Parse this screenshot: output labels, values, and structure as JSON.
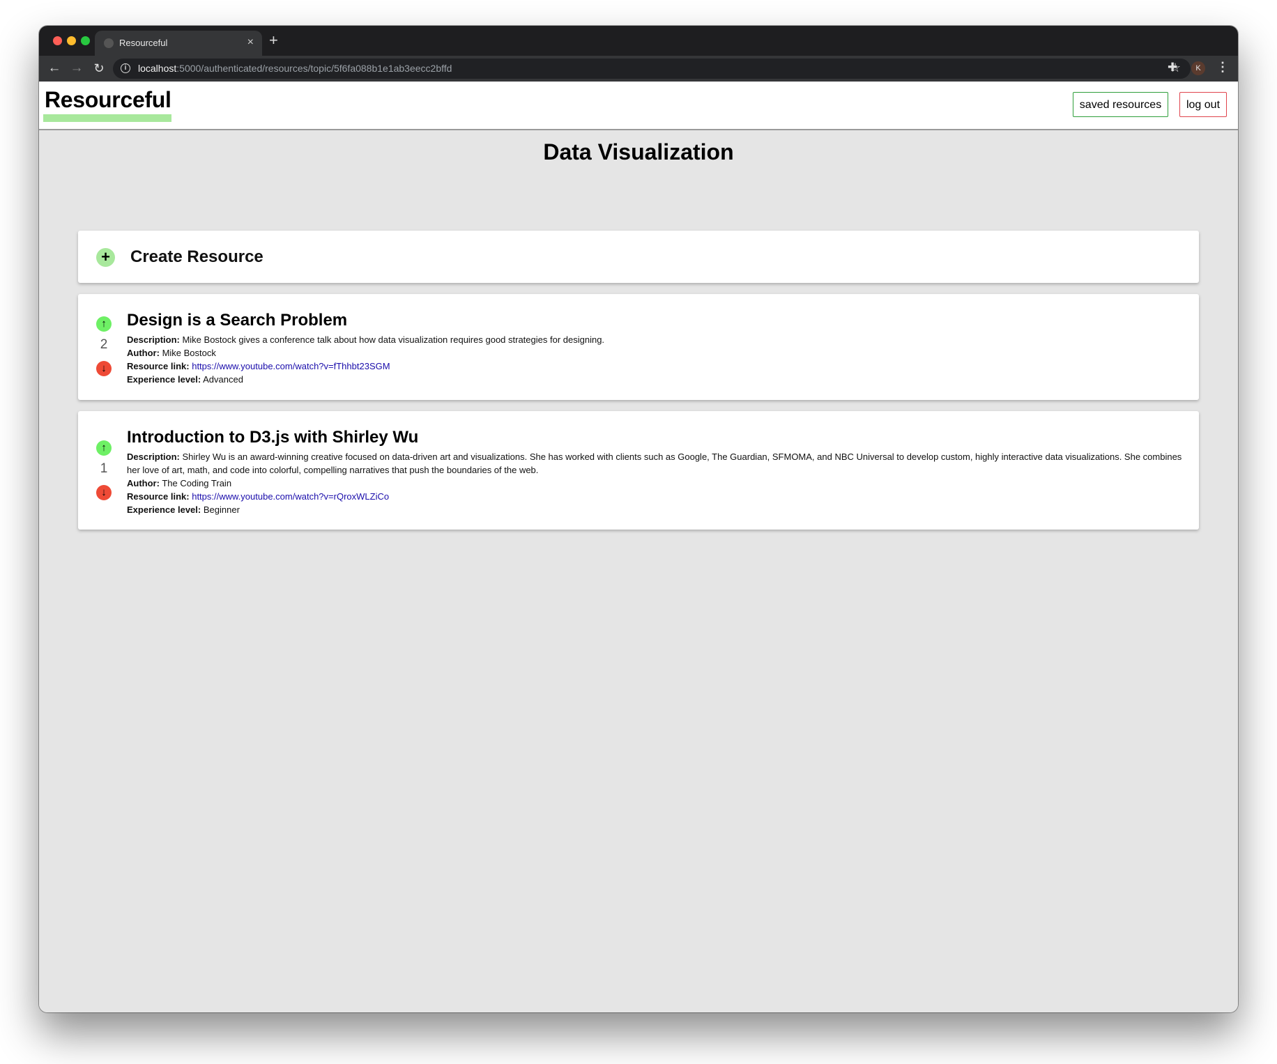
{
  "browser": {
    "tab_title": "Resourceful",
    "tab_close": "×",
    "new_tab": "+",
    "url_host": "localhost",
    "url_rest": ":5000/authenticated/resources/topic/5f6fa088b1e1ab3eecc2bffd",
    "avatar_letter": "K",
    "back_glyph": "←",
    "forward_glyph": "→",
    "reload_glyph": "↻",
    "info_glyph": "i",
    "star_glyph": "☆",
    "extensions_glyph": "✚",
    "menu_glyph": "⋮"
  },
  "header": {
    "brand": "Resourceful",
    "saved_label": "saved resources",
    "logout_label": "log out",
    "saved_border": "#2e9e3a",
    "logout_border": "#e0434c",
    "brand_underline": "#a8e89c"
  },
  "topic": {
    "title": "Data Visualization"
  },
  "create": {
    "icon": "+",
    "label": "Create Resource"
  },
  "labels": {
    "description": "Description:",
    "author": "Author:",
    "link": "Resource link:",
    "level": "Experience level:"
  },
  "resources": [
    {
      "title": "Design is a Search Problem",
      "votes": "2",
      "description": "Mike Bostock gives a conference talk about how data visualization requires good strategies for designing.",
      "author": "Mike Bostock",
      "link": "https://www.youtube.com/watch?v=fThhbt23SGM",
      "level": "Advanced"
    },
    {
      "title": "Introduction to D3.js with Shirley Wu",
      "votes": "1",
      "description": "Shirley Wu is an award-winning creative focused on data-driven art and visualizations. She has worked with clients such as Google, The Guardian, SFMOMA, and NBC Universal to develop custom, highly interactive data visualizations. She combines her love of art, math, and code into colorful, compelling narratives that push the boundaries of the web.",
      "author": "The Coding Train",
      "link": "https://www.youtube.com/watch?v=rQroxWLZiCo",
      "level": "Beginner"
    }
  ],
  "vote_icons": {
    "up": "↑",
    "down": "↓"
  },
  "colors": {
    "upvote": "#6ef065",
    "downvote": "#ee4a36",
    "link": "#1a0dab",
    "page_bg": "#e5e5e5"
  }
}
